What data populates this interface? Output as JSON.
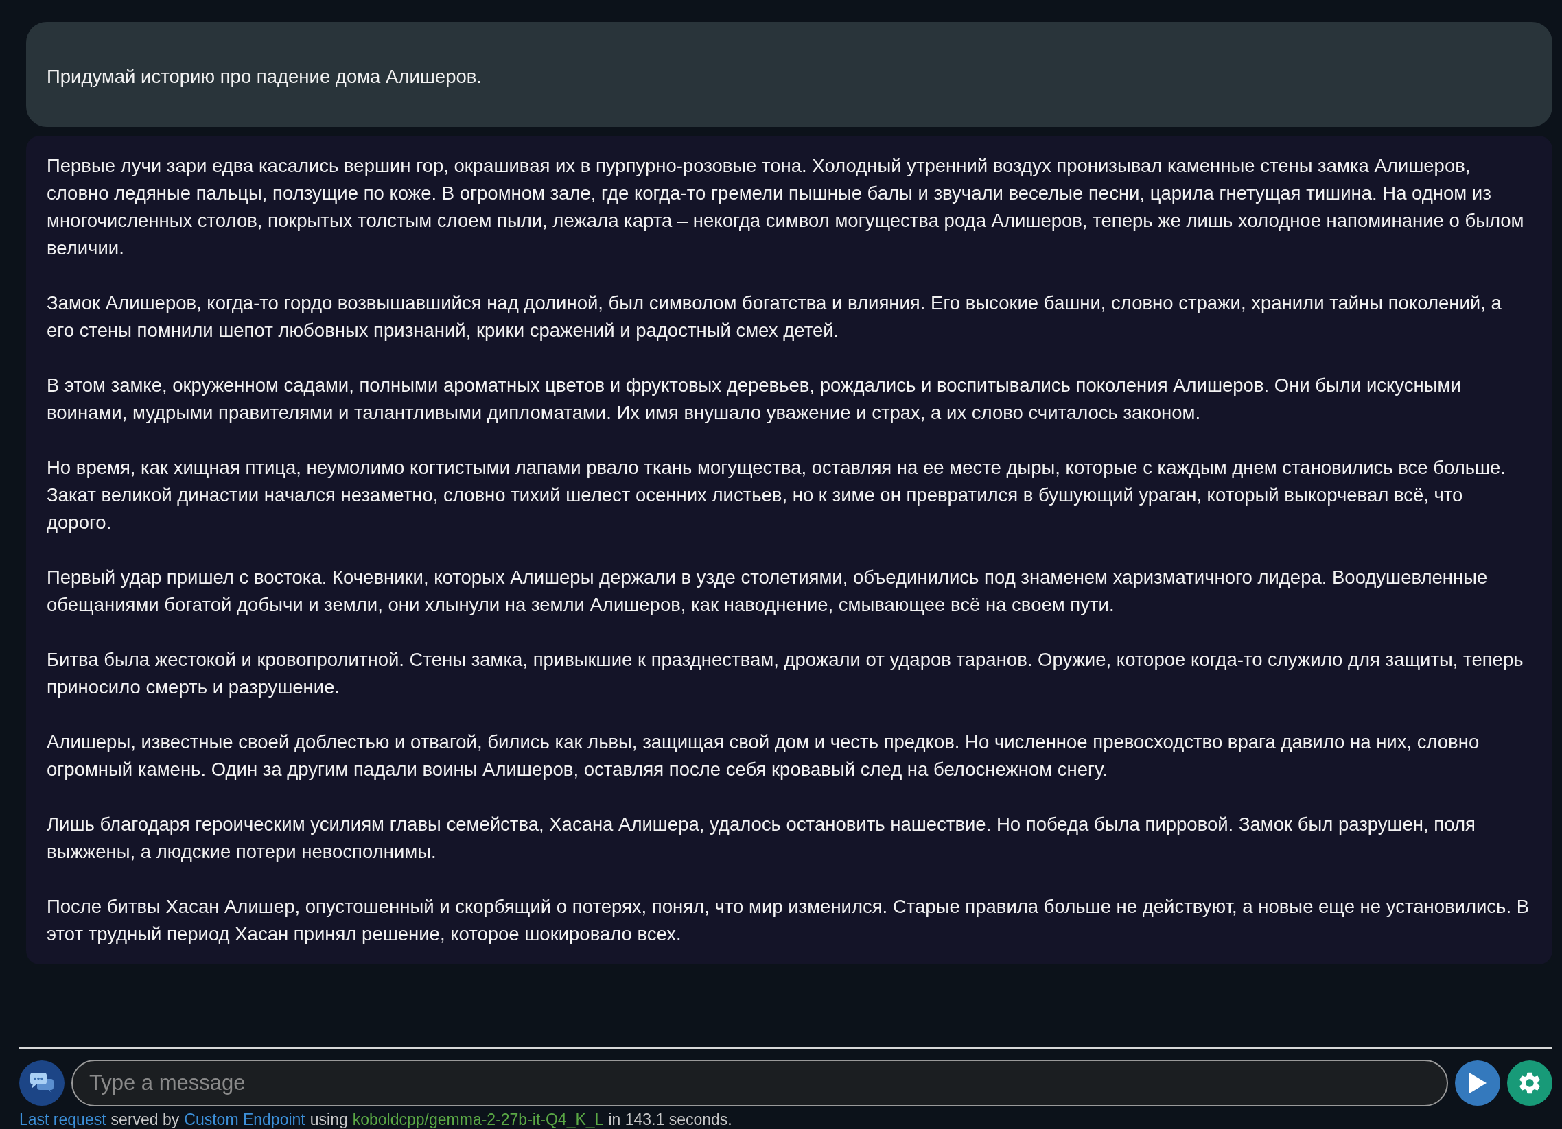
{
  "user_message": {
    "text": "Придумай историю про падение дома Алишеров."
  },
  "ai_message": {
    "paragraphs": [
      "Первые лучи зари едва касались вершин гор, окрашивая их в пурпурно-розовые тона. Холодный утренний воздух пронизывал каменные стены замка Алишеров, словно ледяные пальцы, ползущие по коже. В огромном зале, где когда-то гремели пышные балы и звучали веселые песни, царила гнетущая тишина. На одном из многочисленных столов, покрытых толстым слоем пыли, лежала карта – некогда символ могущества рода Алишеров, теперь же лишь холодное напоминание о былом величии.",
      "Замок Алишеров, когда-то гордо возвышавшийся над долиной, был символом богатства и влияния. Его высокие башни, словно стражи, хранили тайны поколений, а его стены помнили шепот любовных признаний, крики сражений и радостный смех детей.",
      "В этом замке, окруженном садами, полными ароматных цветов и фруктовых деревьев, рождались и воспитывались поколения Алишеров. Они были искусными воинами, мудрыми правителями и талантливыми дипломатами. Их имя внушало уважение и страх, а их слово считалось законом.",
      "Но время, как хищная птица, неумолимо когтистыми лапами рвало ткань могущества, оставляя на ее месте дыры, которые с каждым днем становились все больше. Закат великой династии начался незаметно, словно тихий шелест осенних листьев, но к зиме он превратился в бушующий ураган, который выкорчевал всё, что дорого.",
      "Первый удар пришел с востока. Кочевники, которых Алишеры держали в узде столетиями, объединились под знаменем харизматичного лидера. Воодушевленные обещаниями богатой добычи и земли, они хлынули на земли Алишеров, как наводнение, смывающее всё на своем пути.",
      "Битва была жестокой и кровопролитной. Стены замка, привыкшие к празднествам, дрожали от ударов таранов. Оружие, которое когда-то служило для защиты, теперь приносило смерть и разрушение.",
      "Алишеры, известные своей доблестью и отвагой, бились как львы, защищая свой дом и честь предков. Но численное превосходство врага давило на них, словно огромный камень. Один за другим падали воины Алишеров, оставляя после себя кровавый след на белоснежном снегу.",
      "Лишь благодаря героическим усилиям главы семейства, Хасана Алишера, удалось остановить нашествие. Но победа была пирровой. Замок был разрушен, поля выжжены, а людские потери невосполнимы.",
      "После битвы Хасан Алишер, опустошенный и скорбящий о потерях, понял, что мир изменился. Старые правила больше не действуют, а новые еще не установились. В этот трудный период Хасан принял решение, которое шокировало всех."
    ]
  },
  "input": {
    "placeholder": "Type a message"
  },
  "status": [
    {
      "kind": "link",
      "text": "Last request"
    },
    {
      "kind": "plain",
      "text": "served by"
    },
    {
      "kind": "link",
      "text": "Custom Endpoint"
    },
    {
      "kind": "plain",
      "text": "using"
    },
    {
      "kind": "model",
      "text": "koboldcpp/gemma-2-27b-it-Q4_K_L"
    },
    {
      "kind": "plain",
      "text": "in 143.1 seconds."
    }
  ]
}
